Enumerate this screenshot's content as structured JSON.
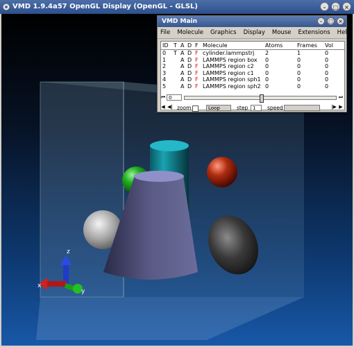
{
  "gl_window": {
    "title": "VMD 1.9.4a57 OpenGL Display (OpenGL - GLSL)"
  },
  "main_window": {
    "title": "VMD Main",
    "menu": [
      "File",
      "Molecule",
      "Graphics",
      "Display",
      "Mouse",
      "Extensions",
      "Help"
    ],
    "columns": {
      "id": "ID",
      "t": "T",
      "a": "A",
      "d": "D",
      "f": "F",
      "molecule": "Molecule",
      "atoms": "Atoms",
      "frames": "Frames",
      "vol": "Vol"
    },
    "rows": [
      {
        "id": "0",
        "t": "T",
        "a": "A",
        "d": "D",
        "f": "F",
        "molecule": "cylinder.lammpstrj",
        "atoms": "2",
        "frames": "1",
        "vol": "0"
      },
      {
        "id": "1",
        "t": "",
        "a": "A",
        "d": "D",
        "f": "F",
        "molecule": "LAMMPS region box",
        "atoms": "0",
        "frames": "0",
        "vol": "0"
      },
      {
        "id": "2",
        "t": "",
        "a": "A",
        "d": "D",
        "f": "F",
        "molecule": "LAMMPS region c2",
        "atoms": "0",
        "frames": "0",
        "vol": "0"
      },
      {
        "id": "3",
        "t": "",
        "a": "A",
        "d": "D",
        "f": "F",
        "molecule": "LAMMPS region c1",
        "atoms": "0",
        "frames": "0",
        "vol": "0"
      },
      {
        "id": "4",
        "t": "",
        "a": "A",
        "d": "D",
        "f": "F",
        "molecule": "LAMMPS region sph1",
        "atoms": "0",
        "frames": "0",
        "vol": "0"
      },
      {
        "id": "5",
        "t": "",
        "a": "A",
        "d": "D",
        "f": "F",
        "molecule": "LAMMPS region sph2",
        "atoms": "0",
        "frames": "0",
        "vol": "0"
      }
    ],
    "frame_value": "0",
    "zoom_label": "zoom",
    "loop_value": "Loop",
    "step_label": "step",
    "step_value": "1",
    "speed_label": "speed"
  },
  "axes": {
    "x": "x",
    "y": "y",
    "z": "z"
  },
  "colors": {
    "title_bar": "#2c4f8c",
    "f_flag": "#d01010"
  }
}
